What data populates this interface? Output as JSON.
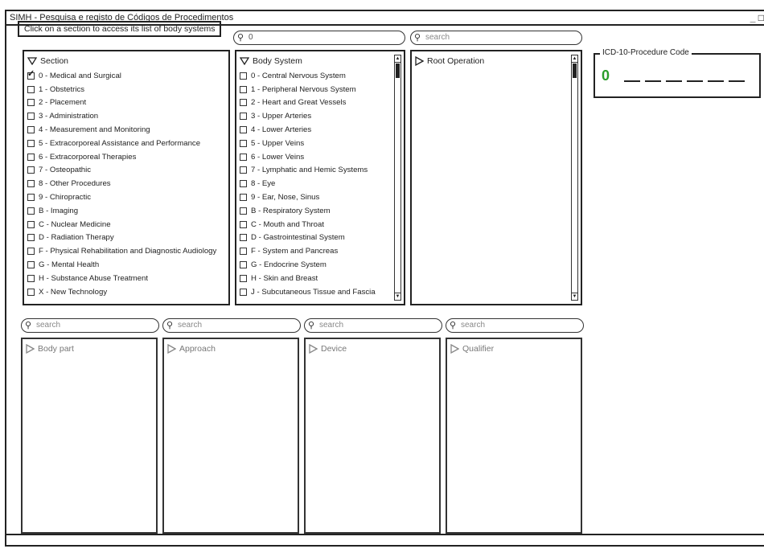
{
  "window": {
    "title": "SIMH - Pesquisa e registo de Códigos de Procedimentos",
    "controls": "_ □"
  },
  "hint": "Click on a section to access its list of body systems",
  "section_search": {
    "value": "0"
  },
  "root_search": {
    "placeholder": "search"
  },
  "section_panel": {
    "title": "Section",
    "items": [
      {
        "label": "0 - Medical and Surgical",
        "checked": true
      },
      {
        "label": "1 - Obstetrics",
        "checked": false
      },
      {
        "label": "2 - Placement",
        "checked": false
      },
      {
        "label": "3 - Administration",
        "checked": false
      },
      {
        "label": "4 - Measurement and Monitoring",
        "checked": false
      },
      {
        "label": "5 - Extracorporeal Assistance and Performance",
        "checked": false
      },
      {
        "label": "6 - Extracorporeal Therapies",
        "checked": false
      },
      {
        "label": "7 - Osteopathic",
        "checked": false
      },
      {
        "label": "8 - Other Procedures",
        "checked": false
      },
      {
        "label": "9 - Chiropractic",
        "checked": false
      },
      {
        "label": "B - Imaging",
        "checked": false
      },
      {
        "label": "C - Nuclear Medicine",
        "checked": false
      },
      {
        "label": "D - Radiation Therapy",
        "checked": false
      },
      {
        "label": "F - Physical Rehabilitation and Diagnostic Audiology",
        "checked": false
      },
      {
        "label": "G - Mental Health",
        "checked": false
      },
      {
        "label": "H - Substance Abuse Treatment",
        "checked": false
      },
      {
        "label": "X - New Technology",
        "checked": false
      }
    ]
  },
  "body_system_panel": {
    "title": "Body System",
    "items": [
      "0 - Central Nervous System",
      "1 - Peripheral Nervous System",
      "2 - Heart and Great Vessels",
      "3 - Upper Arteries",
      "4 - Lower Arteries",
      "5 - Upper Veins",
      "6 - Lower Veins",
      "7 - Lymphatic and Hemic Systems",
      "8 - Eye",
      "9 - Ear, Nose, Sinus",
      "B - Respiratory System",
      "C - Mouth and Throat",
      "D - Gastrointestinal System",
      "F - System and Pancreas",
      "G - Endocrine System",
      "H - Skin and Breast",
      "J - Subcutaneous Tissue and Fascia"
    ]
  },
  "root_operation_panel": {
    "title": "Root Operation"
  },
  "code_box": {
    "legend": "ICD-10-Procedure Code",
    "value": "0"
  },
  "lower_panels": {
    "body_part": {
      "search": "search",
      "title": "Body part"
    },
    "approach": {
      "search": "search",
      "title": "Approach"
    },
    "device": {
      "search": "search",
      "title": "Device"
    },
    "qualifier": {
      "search": "search",
      "title": "Qualifier"
    }
  }
}
